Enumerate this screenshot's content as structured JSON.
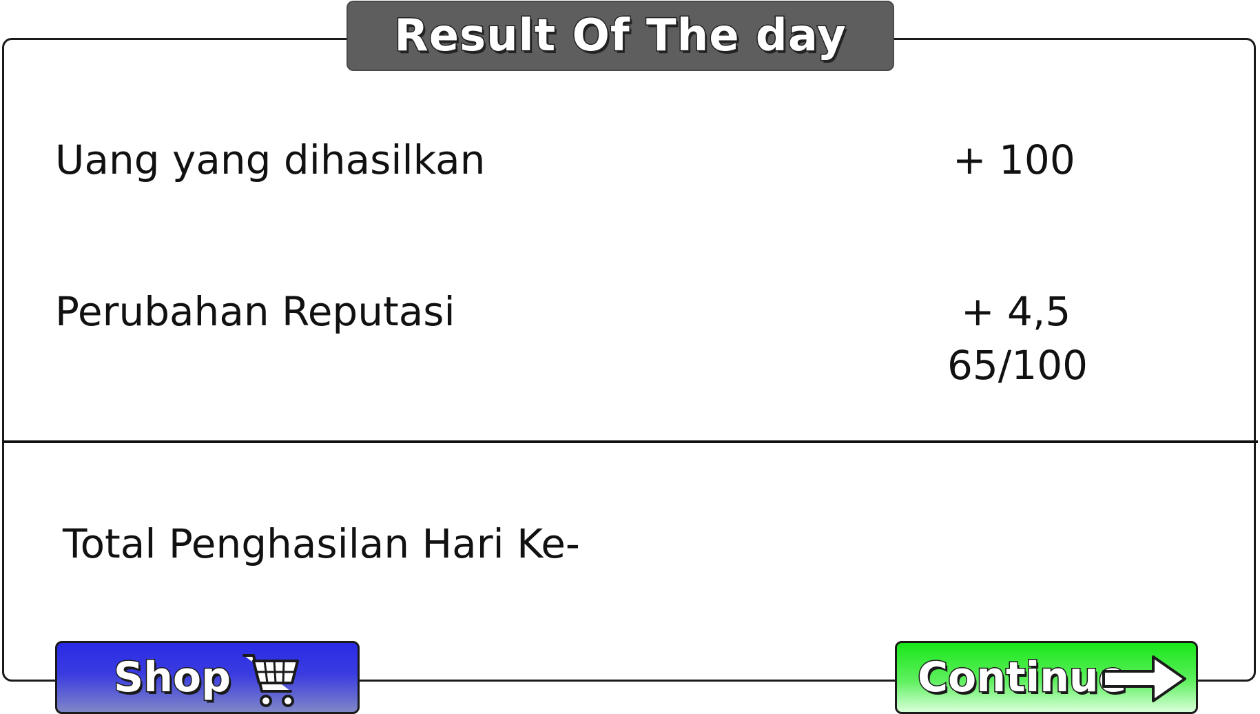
{
  "title": "Result Of The day",
  "rows": [
    {
      "label": "Uang yang dihasilkan",
      "value": "+ 100"
    },
    {
      "label": "Perubahan Reputasi",
      "value": "+ 4,5",
      "sub_value": "65/100"
    }
  ],
  "total": {
    "label": "Total Penghasilan Hari Ke-"
  },
  "buttons": {
    "shop_label": "Shop",
    "shop_icon": "shopping-cart-icon",
    "continue_label": "Continue",
    "continue_icon": "arrow-right-icon"
  },
  "colors": {
    "banner": "#5e5e5e",
    "shop_button": "#2a2ae6",
    "continue_button": "#19e619"
  }
}
